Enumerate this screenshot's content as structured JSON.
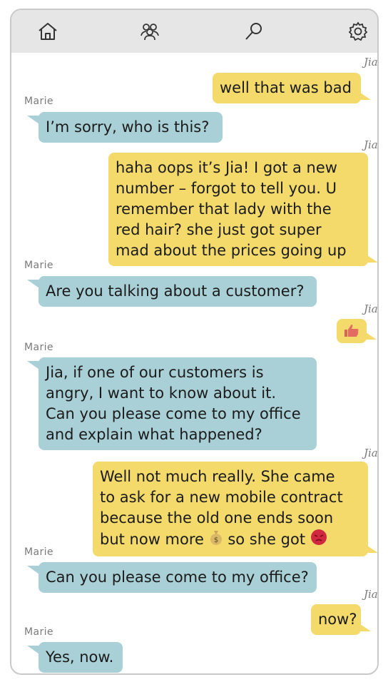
{
  "nav": {
    "items": [
      {
        "id": "home",
        "icon": "home-icon"
      },
      {
        "id": "contacts",
        "icon": "people-icon"
      },
      {
        "id": "search",
        "icon": "search-icon"
      },
      {
        "id": "settings",
        "icon": "gear-icon"
      }
    ],
    "bg": "#e6e6e6"
  },
  "colors": {
    "jia_bubble": "#f3da6a",
    "marie_bubble": "#a9d0d6"
  },
  "messages": [
    {
      "sender": "Jia",
      "lines": [
        "well that was bad"
      ]
    },
    {
      "sender": "Marie",
      "lines": [
        "I’m sorry, who is this?"
      ]
    },
    {
      "sender": "Jia",
      "lines": [
        "haha oops it’s Jia! I got a new",
        "number – forgot to tell you. U",
        "remember that lady with the",
        "red hair? she just got super",
        "mad about the prices going up"
      ]
    },
    {
      "sender": "Marie",
      "lines": [
        "Are you talking about a customer?"
      ]
    },
    {
      "sender": "Jia",
      "lines": [],
      "emoji": "thumbs-up"
    },
    {
      "sender": "Marie",
      "lines": [
        "Jia, if one of our customers is",
        "angry, I want to know about it.",
        "Can you please come to my office",
        "and explain what happened?"
      ]
    },
    {
      "sender": "Jia",
      "lines": [
        "Well not much really. She came",
        "to ask for a new mobile contract",
        "because the old one ends soon",
        "but now more",
        "so she got"
      ],
      "emojis": [
        "money-bag-emoji",
        "angry-face-emoji"
      ]
    },
    {
      "sender": "Marie",
      "lines": [
        "Can you please come to my office?"
      ]
    },
    {
      "sender": "Jia",
      "lines": [
        "now?"
      ]
    },
    {
      "sender": "Marie",
      "lines": [
        "Yes, now."
      ]
    }
  ]
}
